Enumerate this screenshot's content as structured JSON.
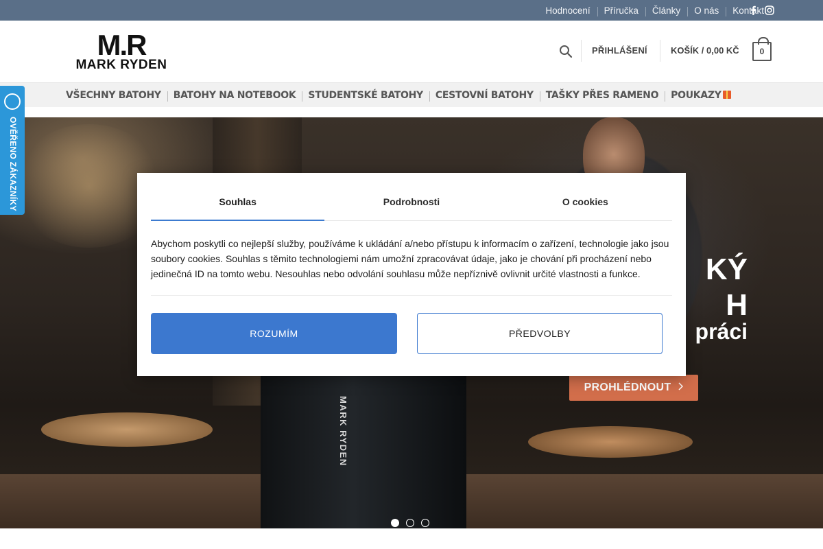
{
  "topbar": {
    "links": [
      "Hodnocení",
      "Příručka",
      "Články",
      "O nás",
      "Kontakt"
    ],
    "social": [
      "facebook-icon",
      "instagram-icon"
    ]
  },
  "header": {
    "logo_text": "M.R MARK RYDEN",
    "login": "PŘIHLÁŠENÍ",
    "cart": "KOŠÍK / 0,00 KČ",
    "cart_count": "0"
  },
  "nav": {
    "items": [
      "VŠECHNY BATOHY",
      "BATOHY NA NOTEBOOK",
      "STUDENTSKÉ BATOHY",
      "CESTOVNÍ BATOHY",
      "TAŠKY PŘES RAMENO",
      "POUKAZY"
    ]
  },
  "badge": {
    "text": "OVĚŘENO ZÁKAZNÍKY"
  },
  "hero": {
    "title_partial": "KÝ\nH",
    "subtitle_partial": "práci",
    "button": "PROHLÉDNOUT",
    "backpack_label": "MARK RYDEN",
    "slides": 3,
    "active_slide": 1
  },
  "cookie": {
    "tabs": [
      "Souhlas",
      "Podrobnosti",
      "O cookies"
    ],
    "active_tab": 0,
    "text": "Abychom poskytli co nejlepší služby, používáme k ukládání a/nebo přístupu k informacím o zařízení, technologie jako jsou soubory cookies. Souhlas s těmito technologiemi nám umožní zpracovávat údaje, jako je chování při procházení nebo jedinečná ID na tomto webu. Nesouhlas nebo odvolání souhlasu může nepříznivě ovlivnit určité vlastnosti a funkce.",
    "accept": "ROZUMÍM",
    "preferences": "PŘEDVOLBY"
  },
  "colors": {
    "topbar": "#5a6f88",
    "accent": "#d26e4b",
    "cookie_blue": "#3c78cf",
    "badge": "#2c97d9"
  }
}
